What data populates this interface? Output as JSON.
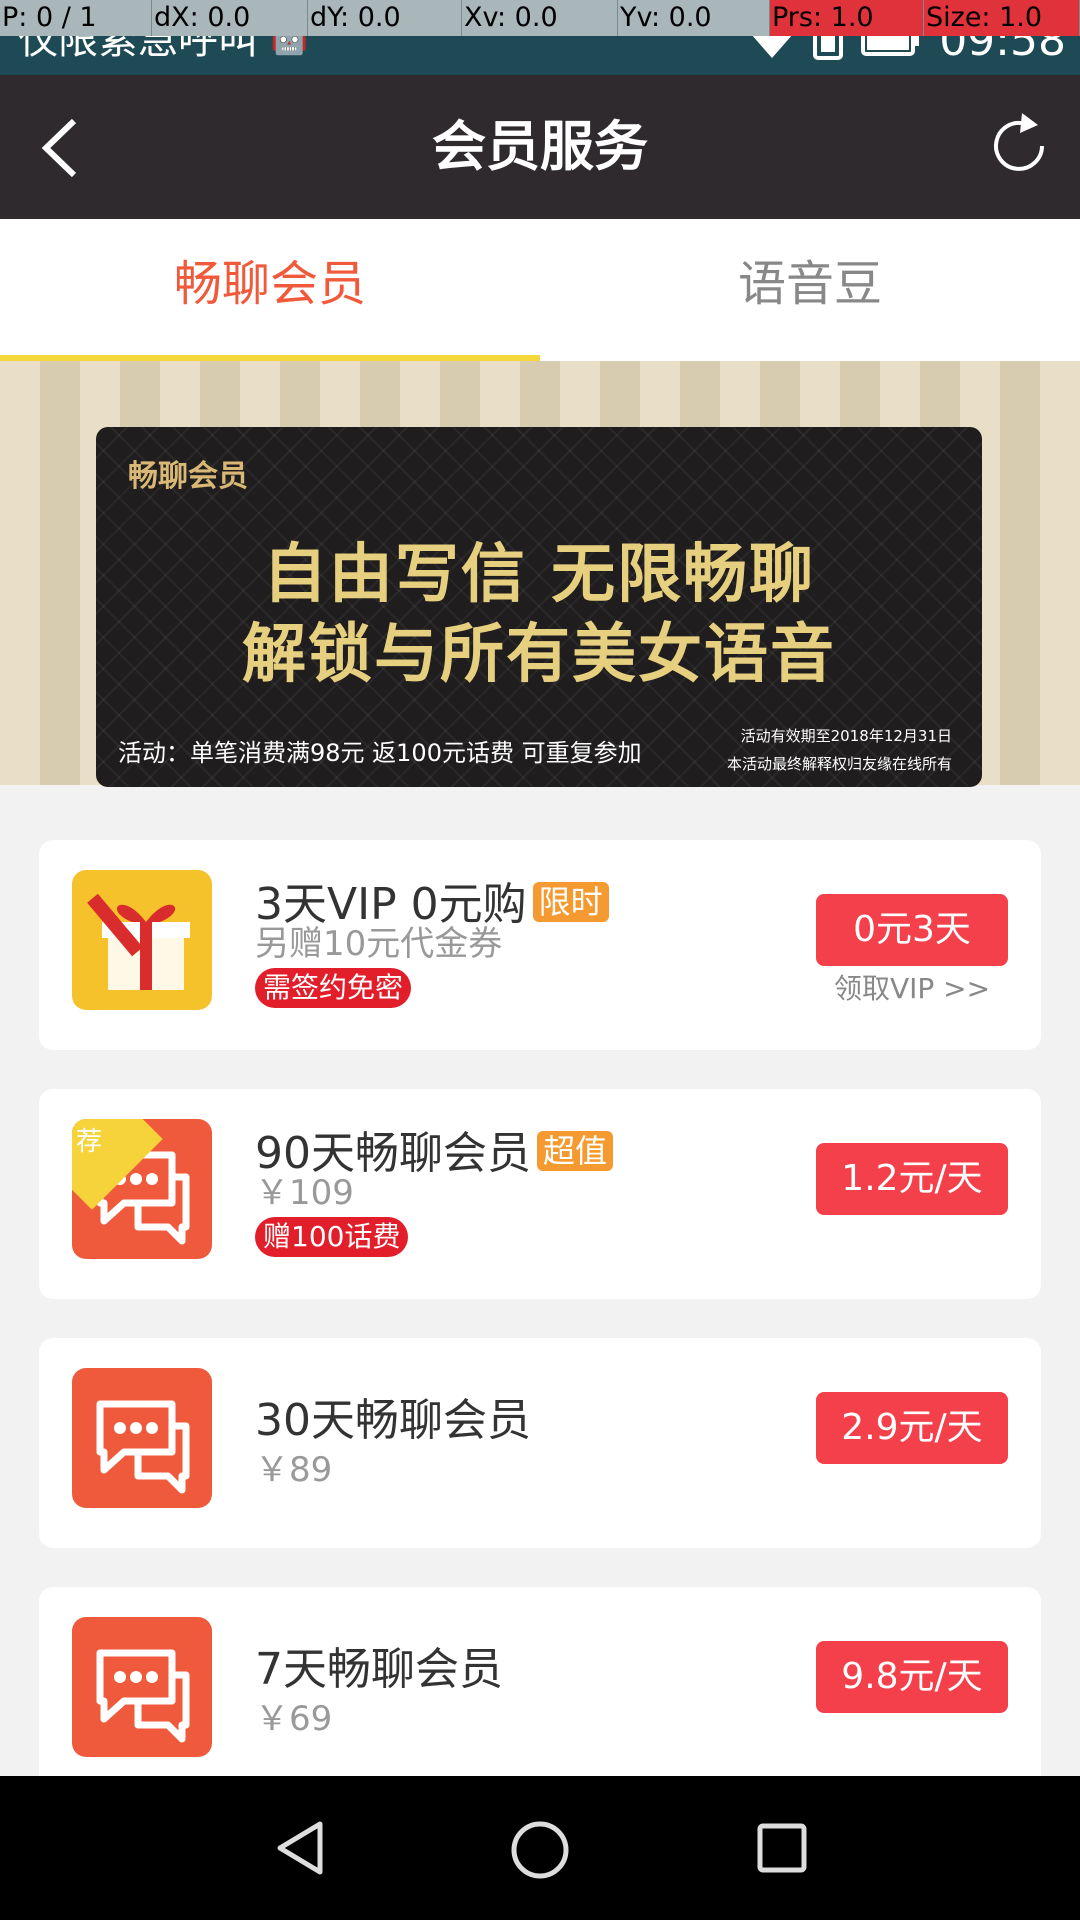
{
  "status_bar": {
    "debug": {
      "p": "P: 0 / 1",
      "dx": "dX: 0.0",
      "dy": "dY: 0.0",
      "xv": "Xv: 0.0",
      "yv": "Yv: 0.0",
      "prs": "Prs: 1.0",
      "size": "Size: 1.0"
    },
    "left_text": "仅限紧急呼叫",
    "time": "09:58",
    "icons": [
      "android-icon",
      "wifi-icon",
      "sim-icon",
      "battery-icon"
    ]
  },
  "app_bar": {
    "title": "会员服务",
    "back_icon": "back-arrow-icon",
    "refresh_icon": "refresh-icon"
  },
  "tabs": [
    {
      "label": "畅聊会员",
      "active": true
    },
    {
      "label": "语音豆",
      "active": false
    }
  ],
  "banner": {
    "tag": "畅聊会员",
    "headline1": "自由写信  无限畅聊",
    "headline2": "解锁与所有美女语音",
    "activity": "活动：单笔消费满98元  返100元话费  可重复参加",
    "note1": "活动有效期至2018年12月31日",
    "note2": "本活动最终解释权归友缘在线所有"
  },
  "items": [
    {
      "title": "3天VIP 0元购",
      "badge": "限时",
      "sub": "另赠10元代金券",
      "red_badge": "需签约免密",
      "button": "0元3天",
      "link": "领取VIP >>",
      "icon": "gift-icon"
    },
    {
      "title": "90天畅聊会员",
      "badge": "超值",
      "sub": "￥109",
      "red_badge": "赠100话费",
      "button": "1.2元/天",
      "corner": "荐",
      "icon": "chat-icon"
    },
    {
      "title": "30天畅聊会员",
      "sub": "￥89",
      "button": "2.9元/天",
      "icon": "chat-icon"
    },
    {
      "title": "7天畅聊会员",
      "sub": "￥69",
      "button": "9.8元/天",
      "icon": "chat-icon"
    }
  ],
  "colors": {
    "accent": "#f05a3a",
    "button": "#f4404a",
    "appbar": "#2e2a2d",
    "tab_indicator": "#f6d73b"
  },
  "nav_bar": {
    "icons": [
      "back-triangle-icon",
      "home-circle-icon",
      "recents-square-icon"
    ]
  }
}
